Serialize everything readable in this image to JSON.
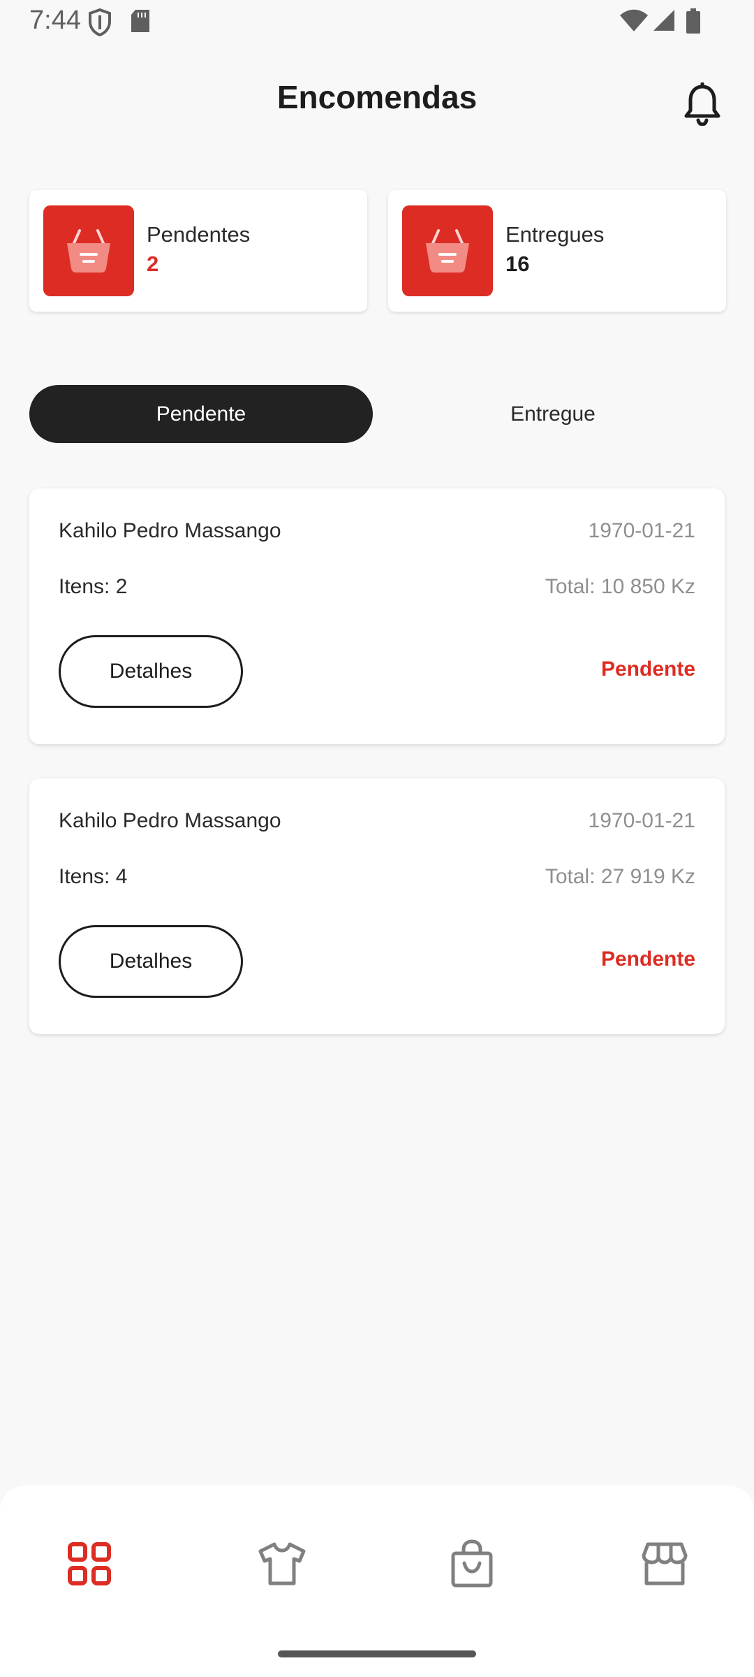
{
  "status_bar": {
    "time": "7:44",
    "icons": [
      "shield-icon",
      "sd-card-icon",
      "wifi-icon",
      "signal-icon",
      "battery-icon"
    ]
  },
  "header": {
    "title": "Encomendas",
    "notification_icon": "bell-icon"
  },
  "summary": {
    "pending": {
      "label": "Pendentes",
      "count": "2",
      "icon": "basket-icon"
    },
    "delivered": {
      "label": "Entregues",
      "count": "16",
      "icon": "basket-icon"
    }
  },
  "tabs": [
    {
      "label": "Pendente",
      "active": true
    },
    {
      "label": "Entregue",
      "active": false
    }
  ],
  "orders": [
    {
      "customer": "Kahilo Pedro Massango",
      "date": "1970-01-21",
      "items": "Itens: 2",
      "total": "Total: 10 850 Kz",
      "details_label": "Detalhes",
      "status": "Pendente"
    },
    {
      "customer": "Kahilo Pedro Massango",
      "date": "1970-01-21",
      "items": "Itens: 4",
      "total": "Total: 27 919 Kz",
      "details_label": "Detalhes",
      "status": "Pendente"
    }
  ],
  "bottom_nav": [
    {
      "icon": "dashboard-grid-icon",
      "active": true
    },
    {
      "icon": "tshirt-icon",
      "active": false
    },
    {
      "icon": "shopping-bag-icon",
      "active": false
    },
    {
      "icon": "store-icon",
      "active": false
    }
  ],
  "colors": {
    "accent": "#dd2c23",
    "dark": "#222222",
    "background": "#f8f8f8",
    "muted": "#8f8f8f"
  }
}
